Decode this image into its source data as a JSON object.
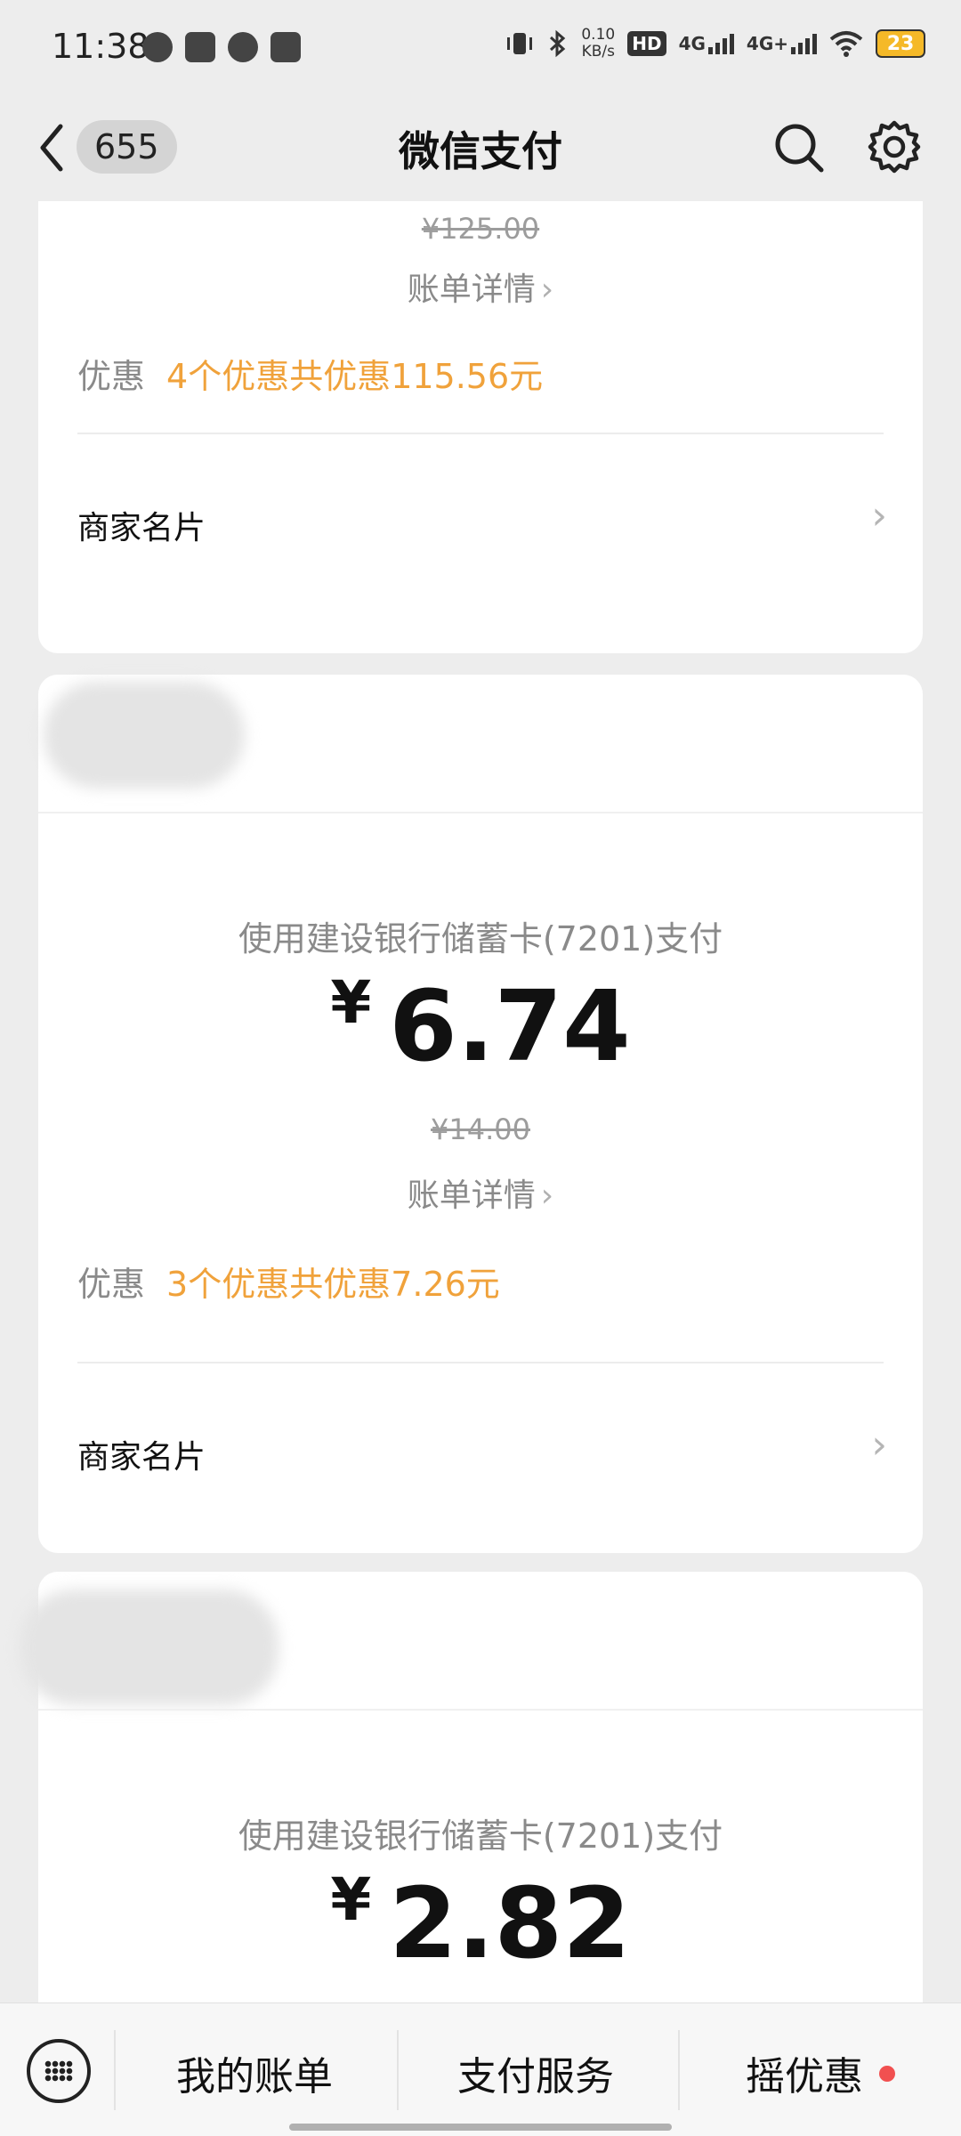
{
  "status_bar": {
    "time": "11:38",
    "speed_value": "0.10",
    "speed_unit": "KB/s",
    "hd": "HD",
    "sim1": "4G",
    "sim2": "4G+",
    "battery": "23"
  },
  "nav": {
    "back_badge": "655",
    "title": "微信支付"
  },
  "cards": [
    {
      "original_price": "¥125.00",
      "detail_label": "账单详情",
      "promo_label": "优惠",
      "promo_value": "4个优惠共优惠115.56元",
      "merchant_card": "商家名片"
    },
    {
      "pay_method": "使用建设银行储蓄卡(7201)支付",
      "currency": "¥",
      "amount": "6.74",
      "original_price": "¥14.00",
      "detail_label": "账单详情",
      "promo_label": "优惠",
      "promo_value": "3个优惠共优惠7.26元",
      "merchant_card": "商家名片"
    },
    {
      "pay_method": "使用建设银行储蓄卡(7201)支付",
      "currency": "¥",
      "amount": "2.82"
    }
  ],
  "bottom_bar": {
    "tabs": [
      "我的账单",
      "支付服务",
      "摇优惠"
    ]
  },
  "colors": {
    "promo": "#f0a23b",
    "background": "#ededed",
    "notification_dot": "#f15050"
  }
}
